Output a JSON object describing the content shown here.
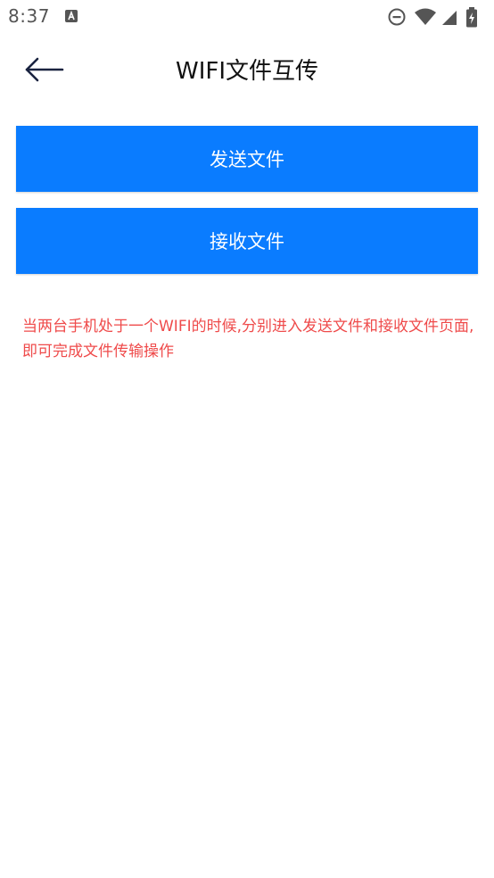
{
  "status_bar": {
    "time": "8:37",
    "icons": [
      "notification-a-icon",
      "do-not-disturb-icon",
      "wifi-icon",
      "cell-signal-icon",
      "battery-charging-icon"
    ]
  },
  "toolbar": {
    "title": "WIFI文件互传",
    "back_icon": "back-arrow-icon"
  },
  "actions": {
    "send_label": "发送文件",
    "receive_label": "接收文件"
  },
  "hint": {
    "text": "当两台手机处于一个WIFI的时候,分别进入发送文件和接收文件页面,即可完成文件传输操作"
  },
  "colors": {
    "primary_button": "#0a7cff",
    "hint_text": "#ef4b4b"
  }
}
